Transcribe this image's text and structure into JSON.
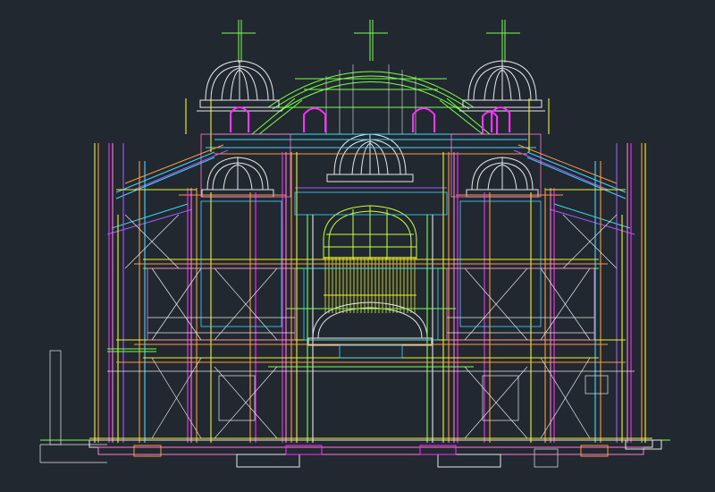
{
  "drawing": {
    "background": "#212830",
    "layer_colors": {
      "white": "#e8e8e8",
      "green": "#7cff4a",
      "magenta": "#ff2bff",
      "yellow": "#f3f322",
      "orange": "#ff9a3c",
      "cyan": "#3fd9ff",
      "pink": "#ff7bd7",
      "violet": "#a45cff",
      "lime": "#c8ff3a",
      "blue": "#6f8cff",
      "red": "#ff4a4a"
    },
    "symbols": [
      "cross-icon",
      "dome-icon",
      "arched-window-icon"
    ]
  }
}
